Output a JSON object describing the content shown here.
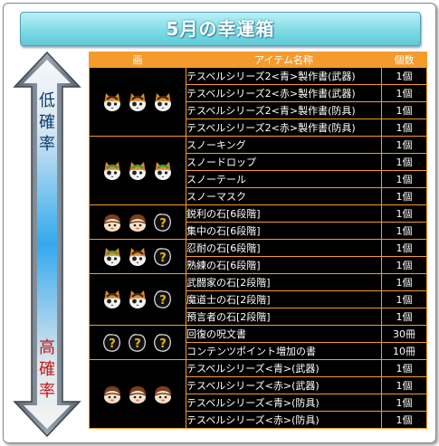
{
  "title": "5月の幸運箱",
  "arrow": {
    "low_label": [
      "低",
      "確",
      "率"
    ],
    "high_label": [
      "高",
      "確",
      "率"
    ]
  },
  "table": {
    "headers": {
      "icon": "画",
      "name": "アイテム名称",
      "count": "個数"
    },
    "groups": [
      {
        "icons": [
          "cat-orange",
          "cat-orange",
          "cat-orange"
        ],
        "items": [
          {
            "name": "テスベルシリーズ2<青>製作書(武器)",
            "count": "1個"
          },
          {
            "name": "テスベルシリーズ2<赤>製作書(武器)",
            "count": "1個"
          },
          {
            "name": "テスベルシリーズ2<青>製作書(防具)",
            "count": "1個"
          },
          {
            "name": "テスベルシリーズ2<赤>製作書(防具)",
            "count": "1個"
          }
        ]
      },
      {
        "icons": [
          "cat-green",
          "cat-green",
          "cat-green"
        ],
        "items": [
          {
            "name": "スノーキング",
            "count": "1個"
          },
          {
            "name": "スノードロップ",
            "count": "1個"
          },
          {
            "name": "スノーテール",
            "count": "1個"
          },
          {
            "name": "スノーマスク",
            "count": "1個"
          }
        ]
      },
      {
        "icons": [
          "chestnut",
          "chestnut",
          "question"
        ],
        "items": [
          {
            "name": "鋭利の石[6段階]",
            "count": "1個"
          },
          {
            "name": "集中の石[6段階]",
            "count": "1個"
          }
        ]
      },
      {
        "icons": [
          "cat-green",
          "cat-orange",
          "question"
        ],
        "items": [
          {
            "name": "忍耐の石[6段階]",
            "count": "1個"
          },
          {
            "name": "熟練の石[6段階]",
            "count": "1個"
          }
        ]
      },
      {
        "icons": [
          "cat-orange",
          "cat-orange",
          "question"
        ],
        "items": [
          {
            "name": "武闘家の石[2段階]",
            "count": "1個"
          },
          {
            "name": "魔道士の石[2段階]",
            "count": "1個"
          },
          {
            "name": "預言者の石[2段階]",
            "count": "1個"
          }
        ]
      },
      {
        "icons": [
          "question",
          "question",
          "question"
        ],
        "items": [
          {
            "name": "回復の呪文書",
            "count": "30冊"
          },
          {
            "name": "コンテンツポイント増加の書",
            "count": "10冊"
          }
        ]
      },
      {
        "icons": [
          "chestnut",
          "chestnut",
          "chestnut"
        ],
        "items": [
          {
            "name": "テスベルシリーズ<青>(武器)",
            "count": "1個"
          },
          {
            "name": "テスベルシリーズ<赤>(武器)",
            "count": "1個"
          },
          {
            "name": "テスベルシリーズ<青>(防具)",
            "count": "1個"
          },
          {
            "name": "テスベルシリーズ<赤>(防具)",
            "count": "1個"
          }
        ]
      }
    ]
  }
}
